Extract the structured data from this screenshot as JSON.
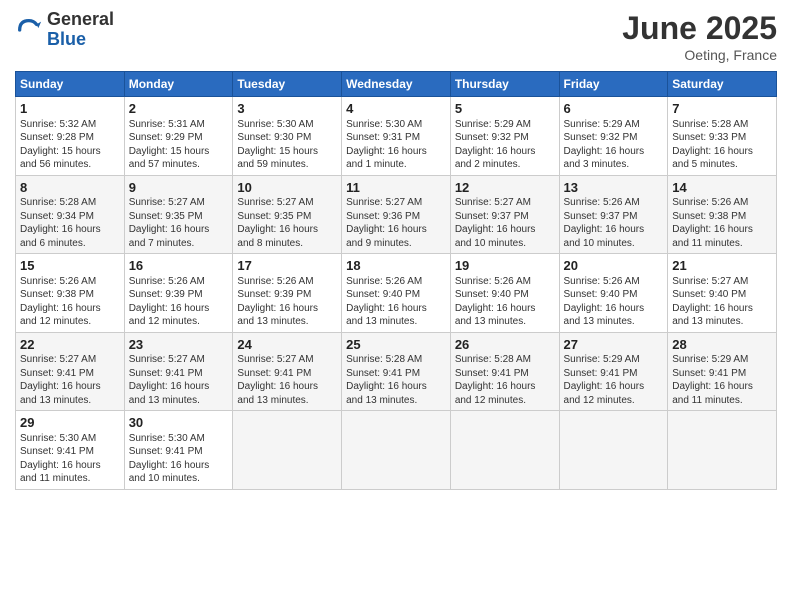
{
  "logo": {
    "general": "General",
    "blue": "Blue"
  },
  "header": {
    "month": "June 2025",
    "location": "Oeting, France"
  },
  "days_of_week": [
    "Sunday",
    "Monday",
    "Tuesday",
    "Wednesday",
    "Thursday",
    "Friday",
    "Saturday"
  ],
  "weeks": [
    [
      {
        "day": "1",
        "info": "Sunrise: 5:32 AM\nSunset: 9:28 PM\nDaylight: 15 hours\nand 56 minutes."
      },
      {
        "day": "2",
        "info": "Sunrise: 5:31 AM\nSunset: 9:29 PM\nDaylight: 15 hours\nand 57 minutes."
      },
      {
        "day": "3",
        "info": "Sunrise: 5:30 AM\nSunset: 9:30 PM\nDaylight: 15 hours\nand 59 minutes."
      },
      {
        "day": "4",
        "info": "Sunrise: 5:30 AM\nSunset: 9:31 PM\nDaylight: 16 hours\nand 1 minute."
      },
      {
        "day": "5",
        "info": "Sunrise: 5:29 AM\nSunset: 9:32 PM\nDaylight: 16 hours\nand 2 minutes."
      },
      {
        "day": "6",
        "info": "Sunrise: 5:29 AM\nSunset: 9:32 PM\nDaylight: 16 hours\nand 3 minutes."
      },
      {
        "day": "7",
        "info": "Sunrise: 5:28 AM\nSunset: 9:33 PM\nDaylight: 16 hours\nand 5 minutes."
      }
    ],
    [
      {
        "day": "8",
        "info": "Sunrise: 5:28 AM\nSunset: 9:34 PM\nDaylight: 16 hours\nand 6 minutes."
      },
      {
        "day": "9",
        "info": "Sunrise: 5:27 AM\nSunset: 9:35 PM\nDaylight: 16 hours\nand 7 minutes."
      },
      {
        "day": "10",
        "info": "Sunrise: 5:27 AM\nSunset: 9:35 PM\nDaylight: 16 hours\nand 8 minutes."
      },
      {
        "day": "11",
        "info": "Sunrise: 5:27 AM\nSunset: 9:36 PM\nDaylight: 16 hours\nand 9 minutes."
      },
      {
        "day": "12",
        "info": "Sunrise: 5:27 AM\nSunset: 9:37 PM\nDaylight: 16 hours\nand 10 minutes."
      },
      {
        "day": "13",
        "info": "Sunrise: 5:26 AM\nSunset: 9:37 PM\nDaylight: 16 hours\nand 10 minutes."
      },
      {
        "day": "14",
        "info": "Sunrise: 5:26 AM\nSunset: 9:38 PM\nDaylight: 16 hours\nand 11 minutes."
      }
    ],
    [
      {
        "day": "15",
        "info": "Sunrise: 5:26 AM\nSunset: 9:38 PM\nDaylight: 16 hours\nand 12 minutes."
      },
      {
        "day": "16",
        "info": "Sunrise: 5:26 AM\nSunset: 9:39 PM\nDaylight: 16 hours\nand 12 minutes."
      },
      {
        "day": "17",
        "info": "Sunrise: 5:26 AM\nSunset: 9:39 PM\nDaylight: 16 hours\nand 13 minutes."
      },
      {
        "day": "18",
        "info": "Sunrise: 5:26 AM\nSunset: 9:40 PM\nDaylight: 16 hours\nand 13 minutes."
      },
      {
        "day": "19",
        "info": "Sunrise: 5:26 AM\nSunset: 9:40 PM\nDaylight: 16 hours\nand 13 minutes."
      },
      {
        "day": "20",
        "info": "Sunrise: 5:26 AM\nSunset: 9:40 PM\nDaylight: 16 hours\nand 13 minutes."
      },
      {
        "day": "21",
        "info": "Sunrise: 5:27 AM\nSunset: 9:40 PM\nDaylight: 16 hours\nand 13 minutes."
      }
    ],
    [
      {
        "day": "22",
        "info": "Sunrise: 5:27 AM\nSunset: 9:41 PM\nDaylight: 16 hours\nand 13 minutes."
      },
      {
        "day": "23",
        "info": "Sunrise: 5:27 AM\nSunset: 9:41 PM\nDaylight: 16 hours\nand 13 minutes."
      },
      {
        "day": "24",
        "info": "Sunrise: 5:27 AM\nSunset: 9:41 PM\nDaylight: 16 hours\nand 13 minutes."
      },
      {
        "day": "25",
        "info": "Sunrise: 5:28 AM\nSunset: 9:41 PM\nDaylight: 16 hours\nand 13 minutes."
      },
      {
        "day": "26",
        "info": "Sunrise: 5:28 AM\nSunset: 9:41 PM\nDaylight: 16 hours\nand 12 minutes."
      },
      {
        "day": "27",
        "info": "Sunrise: 5:29 AM\nSunset: 9:41 PM\nDaylight: 16 hours\nand 12 minutes."
      },
      {
        "day": "28",
        "info": "Sunrise: 5:29 AM\nSunset: 9:41 PM\nDaylight: 16 hours\nand 11 minutes."
      }
    ],
    [
      {
        "day": "29",
        "info": "Sunrise: 5:30 AM\nSunset: 9:41 PM\nDaylight: 16 hours\nand 11 minutes."
      },
      {
        "day": "30",
        "info": "Sunrise: 5:30 AM\nSunset: 9:41 PM\nDaylight: 16 hours\nand 10 minutes."
      },
      {
        "day": "",
        "info": ""
      },
      {
        "day": "",
        "info": ""
      },
      {
        "day": "",
        "info": ""
      },
      {
        "day": "",
        "info": ""
      },
      {
        "day": "",
        "info": ""
      }
    ]
  ]
}
